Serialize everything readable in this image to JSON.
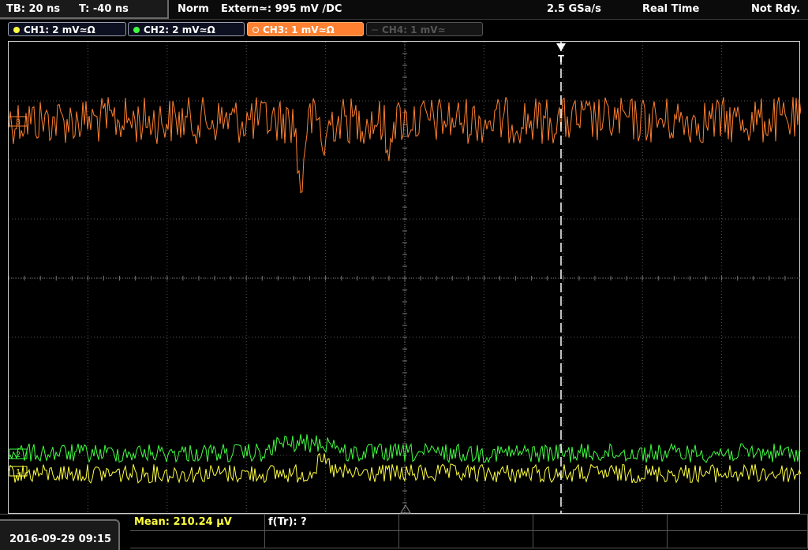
{
  "topbar": {
    "timebase": "TB: 20 ns",
    "trigger_time": "T: -40 ns",
    "mode": "Norm",
    "trigger_source": "Extern≃: 995 mV ∕DC",
    "sample_rate": "2.5 GSa/s",
    "acq_mode": "Real Time",
    "status": "Not Rdy."
  },
  "channels": [
    {
      "label": "CH1: 2 mV≃Ω",
      "color": "#ffff40",
      "state": "on"
    },
    {
      "label": "CH2: 2 mV≃Ω",
      "color": "#40ff40",
      "state": "on"
    },
    {
      "label": "CH3: 1 mV≃Ω",
      "color": "#ff8030",
      "state": "active"
    },
    {
      "label": "CH4: 1 mV≃",
      "color": "#555555",
      "state": "off"
    }
  ],
  "markers": {
    "trigger": "T",
    "ch3": "3",
    "ch2": "2",
    "ch1": "1"
  },
  "bottom": {
    "datetime": "2016-09-29 09:15",
    "mean_label": "Mean: 210.24 µV",
    "ftr_label": "f(Tr): ?"
  },
  "colors": {
    "ch1": "#ffff40",
    "ch2": "#40ff40",
    "ch3": "#ff8030",
    "grid": "#555555",
    "frame": "#cfcfcf"
  }
}
